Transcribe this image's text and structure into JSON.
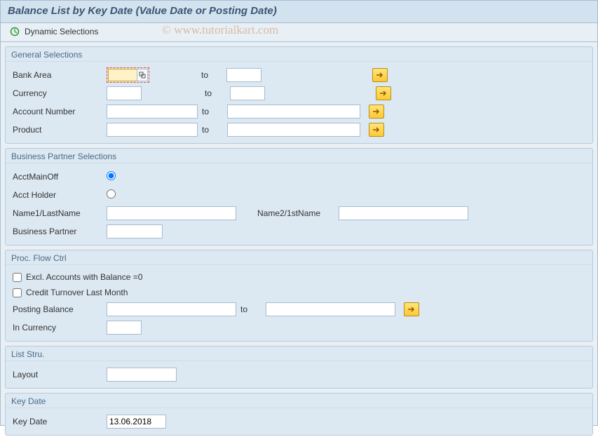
{
  "title": "Balance List by Key Date (Value Date or Posting Date)",
  "toolbar": {
    "dynamic_selections": "Dynamic Selections"
  },
  "to": "to",
  "general": {
    "title": "General Selections",
    "bank_area": "Bank Area",
    "currency": "Currency",
    "account_number": "Account Number",
    "product": "Product"
  },
  "bp": {
    "title": "Business Partner Selections",
    "acct_main_off": "AcctMainOff",
    "acct_holder": "Acct Holder",
    "name1": "Name1/LastName",
    "name2": "Name2/1stName",
    "business_partner": "Business Partner"
  },
  "proc": {
    "title": "Proc. Flow Ctrl",
    "excl_zero": "Excl. Accounts with Balance =0",
    "credit_turnover": "Credit Turnover Last Month",
    "posting_balance": "Posting Balance",
    "in_currency": "In Currency"
  },
  "list": {
    "title": "List Stru.",
    "layout": "Layout"
  },
  "keydate": {
    "title": "Key Date",
    "label": "Key Date",
    "value": "13.06.2018"
  },
  "watermark": "© www.tutorialkart.com"
}
